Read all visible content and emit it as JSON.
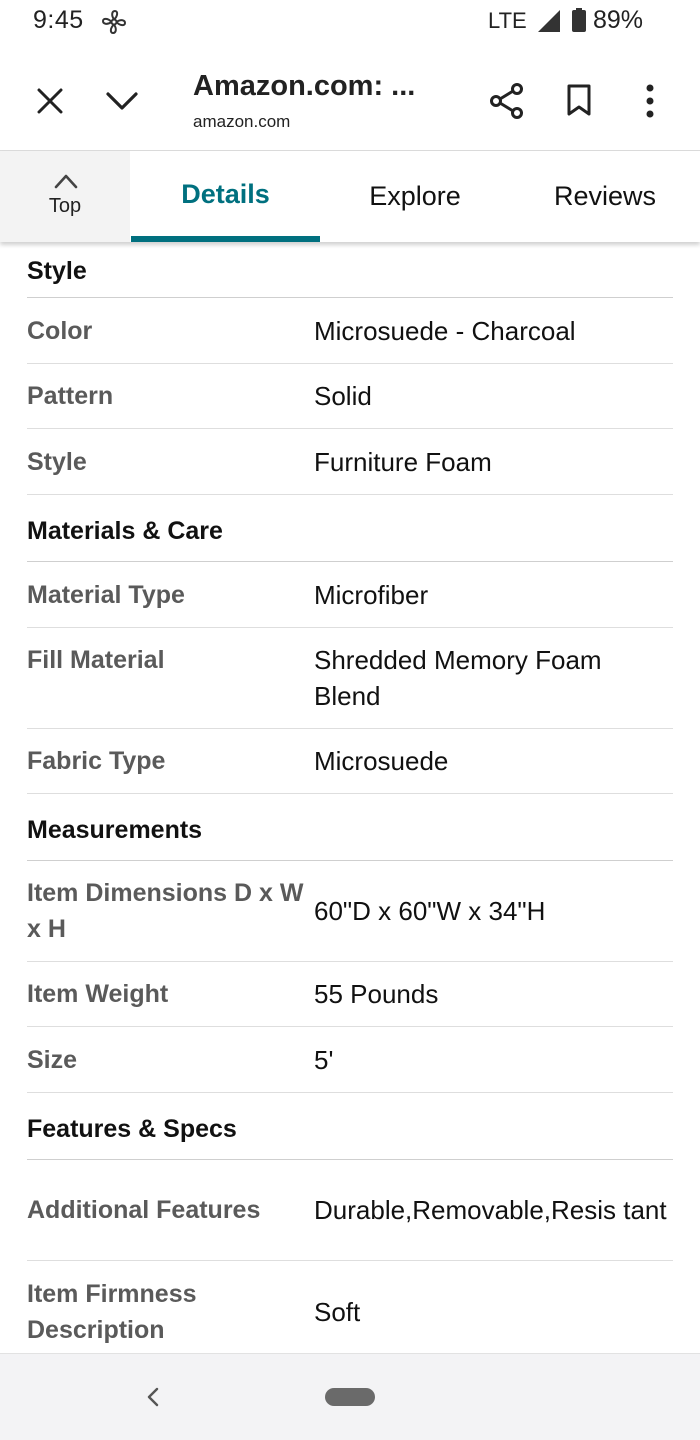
{
  "status_bar": {
    "time": "9:45",
    "network": "LTE",
    "battery": "89%",
    "icons": [
      "fan-icon",
      "signal-icon",
      "battery-icon"
    ]
  },
  "toolbar": {
    "title": "Amazon.com: ...",
    "url": "amazon.com",
    "icons": [
      "close-icon",
      "chevron-down-icon",
      "share-icon",
      "bookmark-icon",
      "more-vert-icon"
    ]
  },
  "tabs": {
    "top_label": "Top",
    "items": [
      {
        "label": "Details",
        "active": true
      },
      {
        "label": "Explore",
        "active": false
      },
      {
        "label": "Reviews",
        "active": false
      }
    ],
    "accent_color": "#00707f"
  },
  "sections": [
    {
      "title": "Style",
      "rows": [
        {
          "label": "Color",
          "value": "Microsuede - Charcoal"
        },
        {
          "label": "Pattern",
          "value": "Solid"
        },
        {
          "label": "Style",
          "value": "Furniture Foam"
        }
      ]
    },
    {
      "title": "Materials & Care",
      "rows": [
        {
          "label": "Material Type",
          "value": "Microfiber"
        },
        {
          "label": "Fill Material",
          "value": "Shredded Memory Foam Blend"
        },
        {
          "label": "Fabric Type",
          "value": "Microsuede"
        }
      ]
    },
    {
      "title": "Measurements",
      "rows": [
        {
          "label": "Item Dimensions D x W x H",
          "value": "60\"D x 60\"W x 34\"H"
        },
        {
          "label": "Item Weight",
          "value": "55 Pounds"
        },
        {
          "label": "Size",
          "value": "5'"
        }
      ]
    },
    {
      "title": "Features & Specs",
      "rows": [
        {
          "label": "Additional Features",
          "value": "Durable,Removable,Resis tant"
        },
        {
          "label": "Item Firmness Description",
          "value": "Soft"
        }
      ]
    }
  ],
  "nav_bar": {
    "icons": [
      "back-icon",
      "home-pill-icon"
    ]
  }
}
